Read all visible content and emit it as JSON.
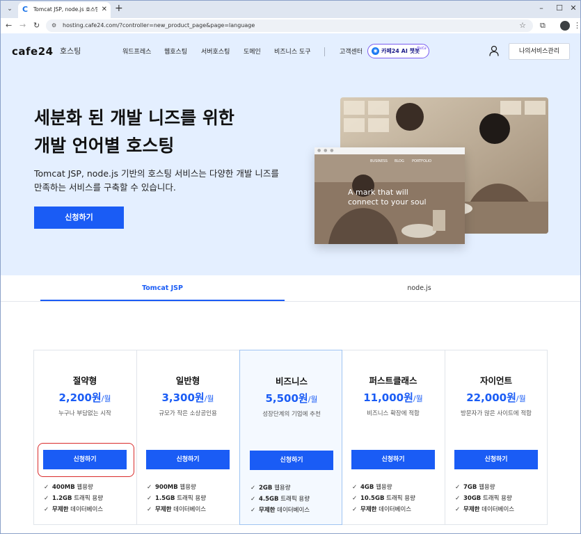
{
  "browser": {
    "tab_title": "Tomcat JSP, node.js 호스팅 | 호",
    "tab_favicon": "C",
    "url": "hosting.cafe24.com/?controller=new_product_page&page=language",
    "icons": [
      "chevron-down-icon",
      "close-icon",
      "plus-icon",
      "minimize-icon",
      "maximize-icon",
      "back-icon",
      "forward-icon",
      "reload-icon",
      "site-info-icon",
      "star-icon",
      "extensions-icon",
      "profile-icon",
      "more-icon"
    ]
  },
  "header": {
    "logo": "cafe24",
    "logo_sub": "호스팅",
    "nav": [
      "워드프레스",
      "웹호스팅",
      "서버호스팅",
      "도메인",
      "비즈니스 도구"
    ],
    "support": "고객센터",
    "ai_chip": "카페24 AI 챗봇",
    "ai_beta": "Beta",
    "my_service": "나의서비스관리"
  },
  "hero": {
    "title_line1": "세분화 된 개발 니즈를 위한",
    "title_line2": "개발 언어별 호스팅",
    "desc_line1": "Tomcat JSP, node.js 기반의 호스팅 서비스는 다양한 개발 니즈를",
    "desc_line2": "만족하는 서비스를 구축할 수 있습니다.",
    "cta": "신청하기",
    "mock_nav": [
      "BUSINESS",
      "BLOG",
      "PORTFOLIO"
    ],
    "mock_headline_1": "A mark that will",
    "mock_headline_2": "connect to your soul"
  },
  "tabs": [
    {
      "label": "Tomcat JSP",
      "active": true
    },
    {
      "label": "node.js",
      "active": false
    }
  ],
  "plans": [
    {
      "name": "절약형",
      "price": "2,200원",
      "unit": "/월",
      "desc": "누구나 부담없는 시작",
      "cta": "신청하기",
      "features": [
        {
          "bold": "400MB",
          "text": " 웹용량"
        },
        {
          "bold": "1.2GB",
          "text": " 트래픽 용량"
        },
        {
          "bold": "무제한",
          "text": " 데이터베이스"
        }
      ]
    },
    {
      "name": "일반형",
      "price": "3,300원",
      "unit": "/월",
      "desc": "규모가 작은 소상공인용",
      "cta": "신청하기",
      "features": [
        {
          "bold": "900MB",
          "text": " 웹용량"
        },
        {
          "bold": "1.5GB",
          "text": " 트래픽 용량"
        },
        {
          "bold": "무제한",
          "text": " 데이터베이스"
        }
      ]
    },
    {
      "name": "비즈니스",
      "price": "5,500원",
      "unit": "/월",
      "desc": "성장단계의 기업에 추천",
      "cta": "신청하기",
      "features": [
        {
          "bold": "2GB",
          "text": " 웹용량"
        },
        {
          "bold": "4.5GB",
          "text": " 트래픽 용량"
        },
        {
          "bold": "무제한",
          "text": " 데이터베이스"
        }
      ]
    },
    {
      "name": "퍼스트클래스",
      "price": "11,000원",
      "unit": "/월",
      "desc": "비즈니스 확장에 적합",
      "cta": "신청하기",
      "features": [
        {
          "bold": "4GB",
          "text": " 웹용량"
        },
        {
          "bold": "10.5GB",
          "text": " 트래픽 용량"
        },
        {
          "bold": "무제한",
          "text": " 데이터베이스"
        }
      ]
    },
    {
      "name": "자이언트",
      "price": "22,000원",
      "unit": "/월",
      "desc": "방문자가 많은 사이트에 적합",
      "cta": "신청하기",
      "features": [
        {
          "bold": "7GB",
          "text": " 웹용량"
        },
        {
          "bold": "30GB",
          "text": " 트래픽 용량"
        },
        {
          "bold": "무제한",
          "text": " 데이터베이스"
        }
      ]
    }
  ],
  "colors": {
    "accent": "#1a5cf5",
    "hero_bg": "#e4efff",
    "highlight": "#d92b2b"
  }
}
